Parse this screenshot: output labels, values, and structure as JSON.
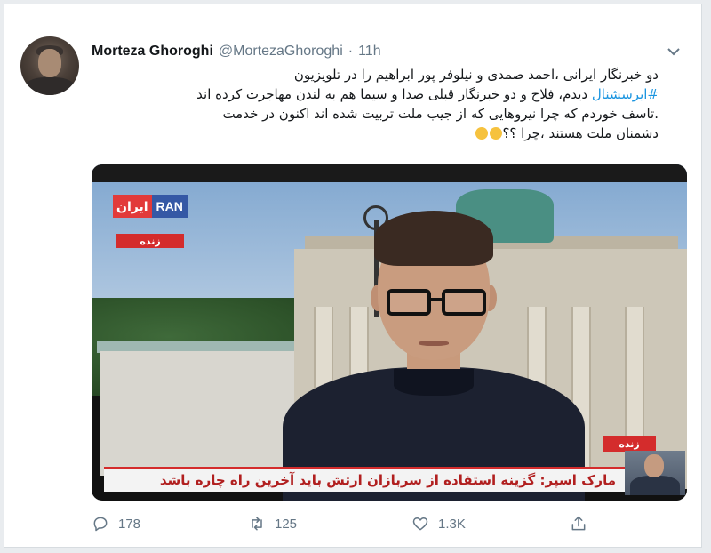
{
  "tweet": {
    "author_name": "Morteza Ghoroghi",
    "handle": "@MortezaGhoroghi",
    "separator": "·",
    "time": "11h",
    "text_lines": {
      "line1": "دو خبرنگار ایرانی ،احمد صمدی و نیلوفر پور ابراهیم را در تلویزیون",
      "hashtag": "#ایرسشنال",
      "line2_rest": " دیدم، فلاح  و دو خبرنگار قبلی صدا و سیما هم به لندن مهاجرت کرده اند",
      "line3": ".تاسف خوردم که چرا نیروهایی که از جیب ملت تربیت شده اند اکنون در خدمت",
      "line4": "دشمنان ملت هستند ،چرا ؟؟"
    }
  },
  "media": {
    "channel_logo_fa": "ایران",
    "channel_logo_en": "RAN",
    "live_label": "زنده",
    "live_label_right": "زنده",
    "lower_third": "مارک اسپر: گزینه استفاده از سربازان ارتش باید آخرین راه چاره باشد"
  },
  "actions": {
    "reply_count": "178",
    "retweet_count": "125",
    "like_count": "1.3K"
  },
  "icons": {
    "reply": "reply-icon",
    "retweet": "retweet-icon",
    "like": "heart-icon",
    "share": "share-icon",
    "caret": "chevron-down-icon",
    "emoji": "persevering-face-emoji"
  },
  "colors": {
    "link": "#1b95e0",
    "secondary_text": "#657786",
    "live_red": "#d42c2c",
    "logo_blue": "#3558a5"
  }
}
